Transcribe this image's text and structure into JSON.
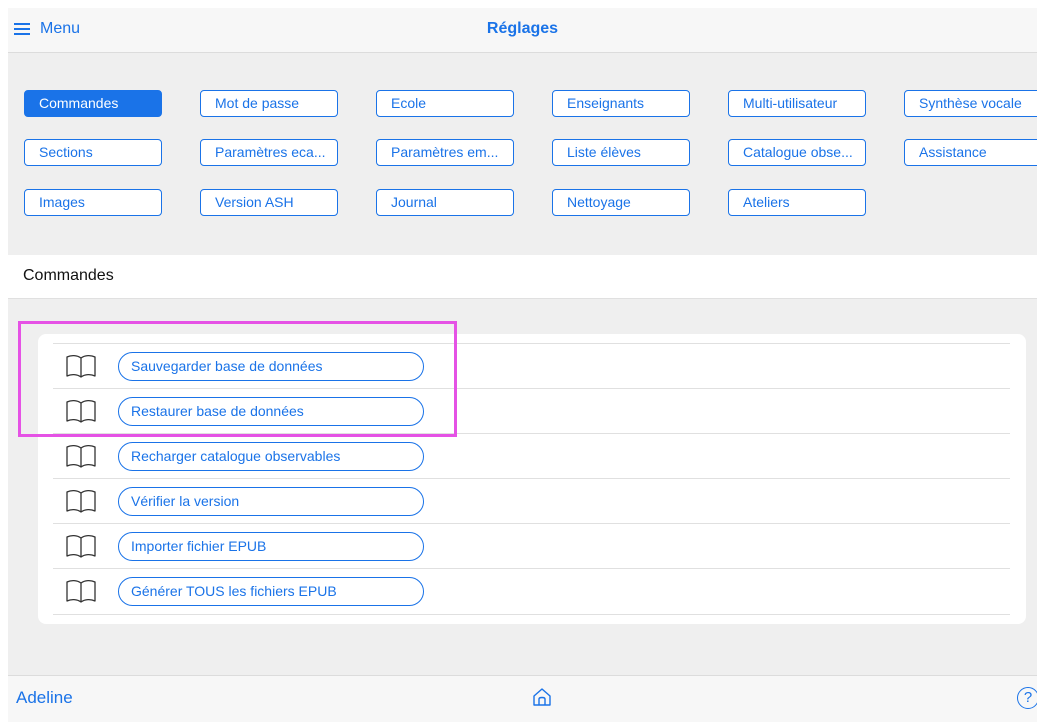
{
  "header": {
    "menu_label": "Menu",
    "title": "Réglages"
  },
  "tabs": [
    {
      "label": "Commandes",
      "active": true
    },
    {
      "label": "Mot de passe"
    },
    {
      "label": "Ecole"
    },
    {
      "label": "Enseignants"
    },
    {
      "label": "Multi-utilisateur"
    },
    {
      "label": "Synthèse vocale"
    },
    {
      "label": "Sections"
    },
    {
      "label": "Paramètres eca..."
    },
    {
      "label": "Paramètres em..."
    },
    {
      "label": "Liste élèves"
    },
    {
      "label": "Catalogue obse..."
    },
    {
      "label": "Assistance"
    },
    {
      "label": "Images"
    },
    {
      "label": "Version ASH"
    },
    {
      "label": "Journal"
    },
    {
      "label": "Nettoyage"
    },
    {
      "label": "Ateliers"
    }
  ],
  "section": {
    "title": "Commandes"
  },
  "commands": [
    {
      "label": "Sauvegarder base de données"
    },
    {
      "label": "Restaurer base de données"
    },
    {
      "label": "Recharger catalogue observables"
    },
    {
      "label": "Vérifier la version"
    },
    {
      "label": "Importer fichier EPUB"
    },
    {
      "label": "Générer TOUS les fichiers EPUB"
    }
  ],
  "footer": {
    "user": "Adeline",
    "help_symbol": "?"
  },
  "icons": {
    "menu": "hamburger-icon",
    "command": "book-icon",
    "home": "home-icon",
    "help": "help-icon"
  },
  "colors": {
    "accent": "#1a73e8",
    "highlight": "#e552e5"
  }
}
